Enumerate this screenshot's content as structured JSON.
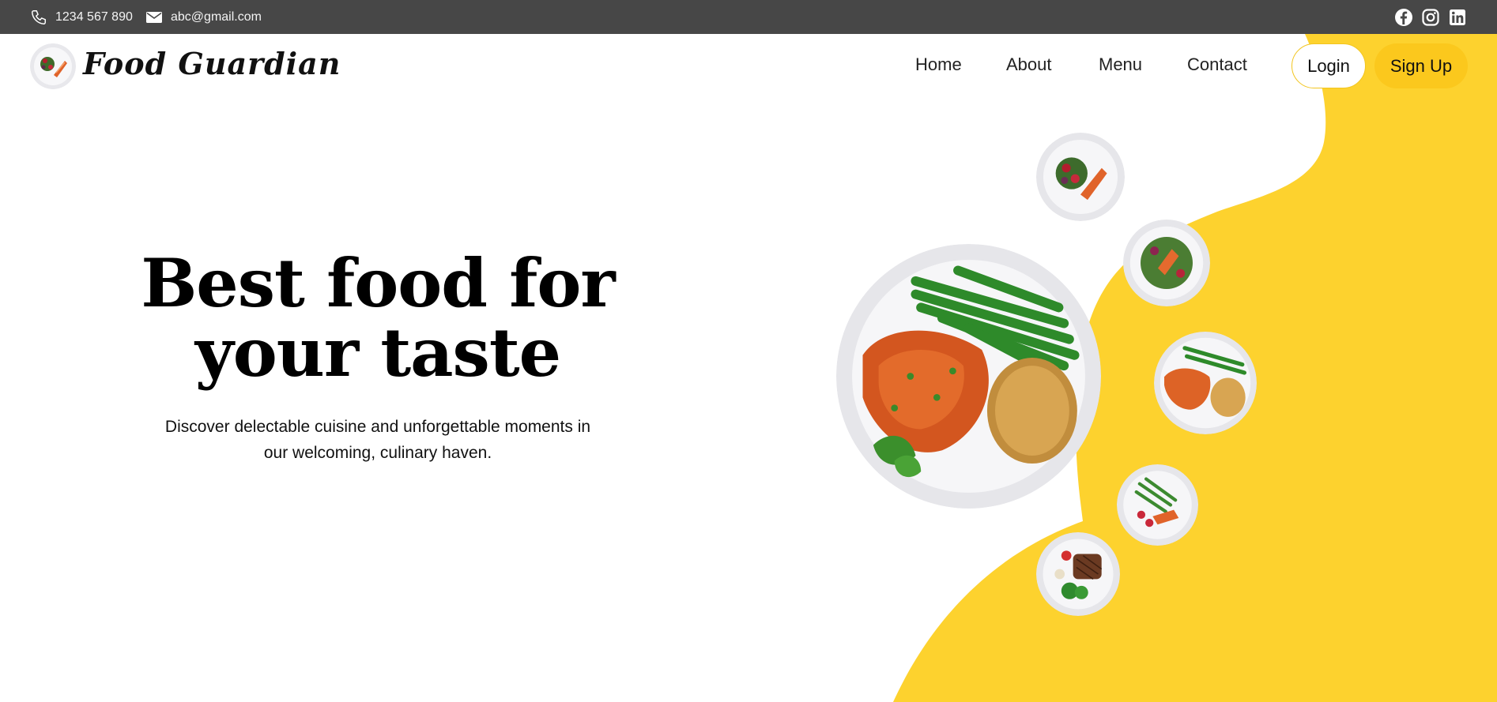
{
  "topbar": {
    "phone": "1234 567 890",
    "email": "abc@gmail.com",
    "social": [
      "facebook-icon",
      "instagram-icon",
      "linkedin-icon"
    ]
  },
  "brand": {
    "name": "Food Guardian"
  },
  "nav": {
    "items": [
      "Home",
      "About",
      "Menu",
      "Contact"
    ]
  },
  "auth": {
    "login": "Login",
    "signup": "Sign Up"
  },
  "hero": {
    "title_line1": "Best food for",
    "title_line2": "your taste",
    "subtitle_line1": "Discover delectable cuisine and unforgettable moments in",
    "subtitle_line2": "our welcoming, culinary haven."
  },
  "colors": {
    "accent": "#fdd22e",
    "topbar": "#474747",
    "button": "#fbc81d"
  }
}
